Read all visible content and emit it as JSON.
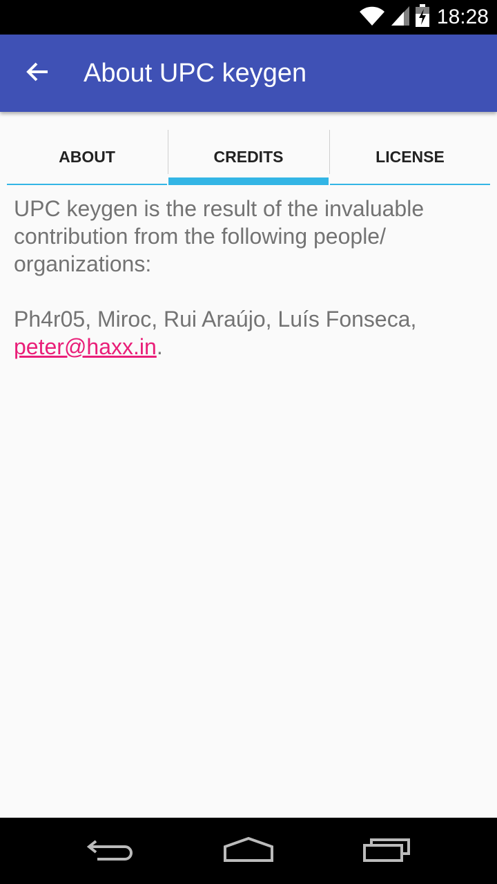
{
  "status_bar": {
    "time": "18:28",
    "icons": [
      "wifi-icon",
      "signal-icon",
      "battery-charging-icon"
    ]
  },
  "app_bar": {
    "back_icon": "arrow-back-icon",
    "title": "About UPC keygen"
  },
  "tabs": [
    {
      "label": "ABOUT",
      "active": false
    },
    {
      "label": "CREDITS",
      "active": true
    },
    {
      "label": "LICENSE",
      "active": false
    }
  ],
  "content": {
    "intro": "UPC keygen is the result of the invaluable contribution from the following people/ organizations:",
    "credits_names": " Ph4r05, Miroc, Rui Araújo, Luís Fonseca, ",
    "credits_email": "peter@haxx.in",
    "credits_end": "."
  },
  "nav_bar": {
    "icons": [
      "back-nav-icon",
      "home-nav-icon",
      "recents-nav-icon"
    ]
  },
  "colors": {
    "app_bar": "#3f51b5",
    "tab_indicator": "#33b5e5",
    "link": "#e91e78",
    "body_text": "#737373",
    "background": "#fafafa"
  }
}
